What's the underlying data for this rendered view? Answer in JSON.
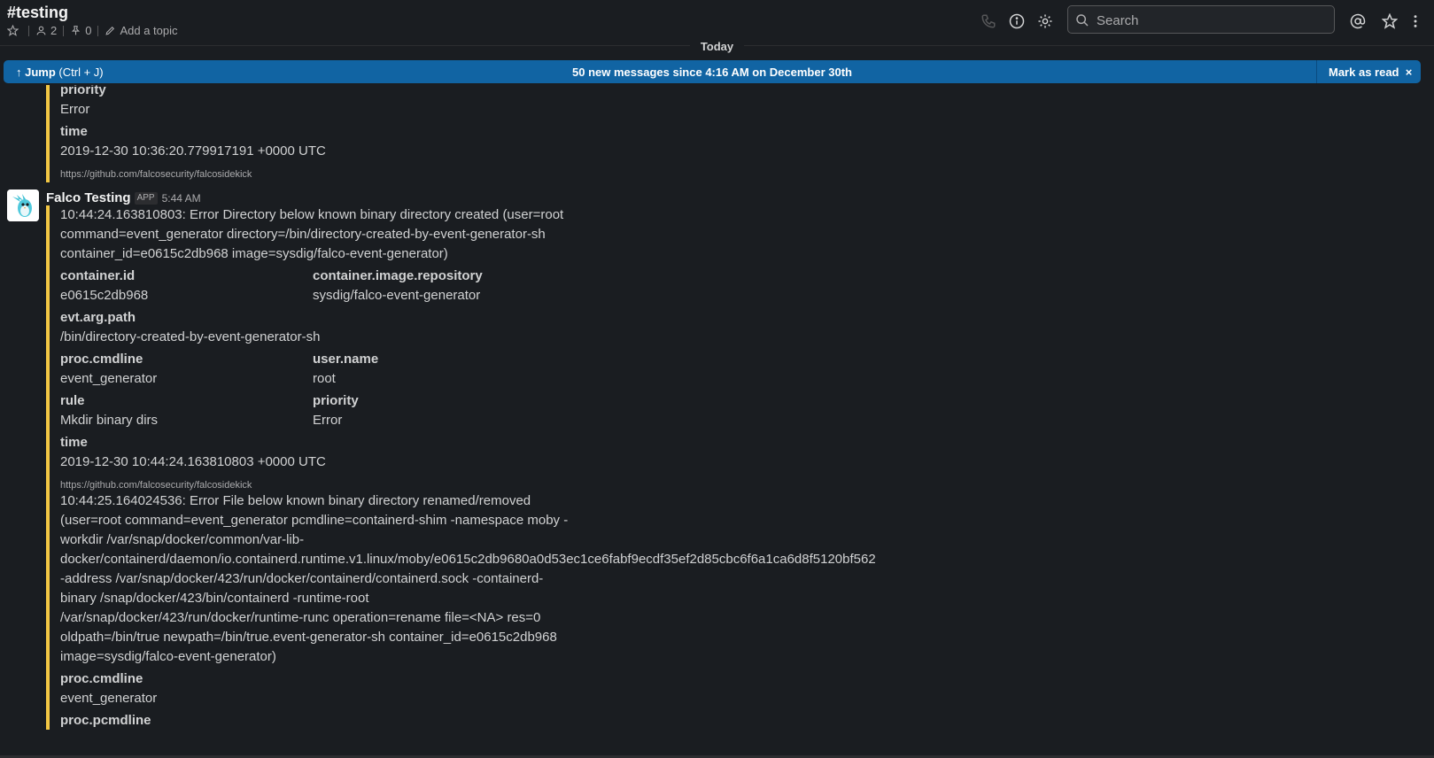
{
  "channel": {
    "name": "#testing",
    "members_count": "2",
    "pins_count": "0",
    "topic_placeholder": "Add a topic"
  },
  "header": {
    "search_placeholder": "Search"
  },
  "divider": {
    "label": "Today"
  },
  "banner": {
    "jump_label": "Jump",
    "jump_shortcut": "(Ctrl + J)",
    "message": "50 new messages since 4:16 AM on December 30th",
    "mark_label": "Mark as read"
  },
  "prev_attachment": {
    "fields": [
      {
        "title": "priority",
        "value": "Error"
      },
      {
        "title": "time",
        "value": "2019-12-30 10:36:20.779917191 +0000 UTC"
      }
    ],
    "footer": "https://github.com/falcosecurity/falcosidekick"
  },
  "message": {
    "sender": "Falco Testing",
    "badge": "APP",
    "time": "5:44 AM",
    "attachments": [
      {
        "text": "10:44:24.163810803: Error Directory below known binary directory created (user=root command=event_generator directory=/bin/directory-created-by-event-generator-sh container_id=e0615c2db968 image=sysdig/falco-event-generator)",
        "fields": [
          {
            "title": "container.id",
            "value": "e0615c2db968"
          },
          {
            "title": "container.image.repository",
            "value": "sysdig/falco-event-generator"
          },
          {
            "title": "evt.arg.path",
            "value": "/bin/directory-created-by-event-generator-sh"
          },
          {
            "title": "proc.cmdline",
            "value": "event_generator"
          },
          {
            "title": "user.name",
            "value": "root"
          },
          {
            "title": "rule",
            "value": "Mkdir binary dirs"
          },
          {
            "title": "priority",
            "value": "Error"
          },
          {
            "title": "time",
            "value": "2019-12-30 10:44:24.163810803 +0000 UTC"
          }
        ],
        "footer": "https://github.com/falcosecurity/falcosidekick"
      },
      {
        "text": "10:44:25.164024536: Error File below known binary directory renamed/removed (user=root command=event_generator pcmdline=containerd-shim -namespace moby -workdir /var/snap/docker/common/var-lib-docker/containerd/daemon/io.containerd.runtime.v1.linux/moby/e0615c2db9680a0d53ec1ce6fabf9ecdf35ef2d85cbc6f6a1ca6d8f5120bf562 -address /var/snap/docker/423/run/docker/containerd/containerd.sock -containerd-binary /snap/docker/423/bin/containerd -runtime-root /var/snap/docker/423/run/docker/runtime-runc operation=rename file=<NA> res=0 oldpath=/bin/true newpath=/bin/true.event-generator-sh container_id=e0615c2db968 image=sysdig/falco-event-generator)",
        "fields": [
          {
            "title": "proc.cmdline",
            "value": "event_generator"
          },
          {
            "title": "proc.pcmdline",
            "value": ""
          }
        ]
      }
    ]
  }
}
